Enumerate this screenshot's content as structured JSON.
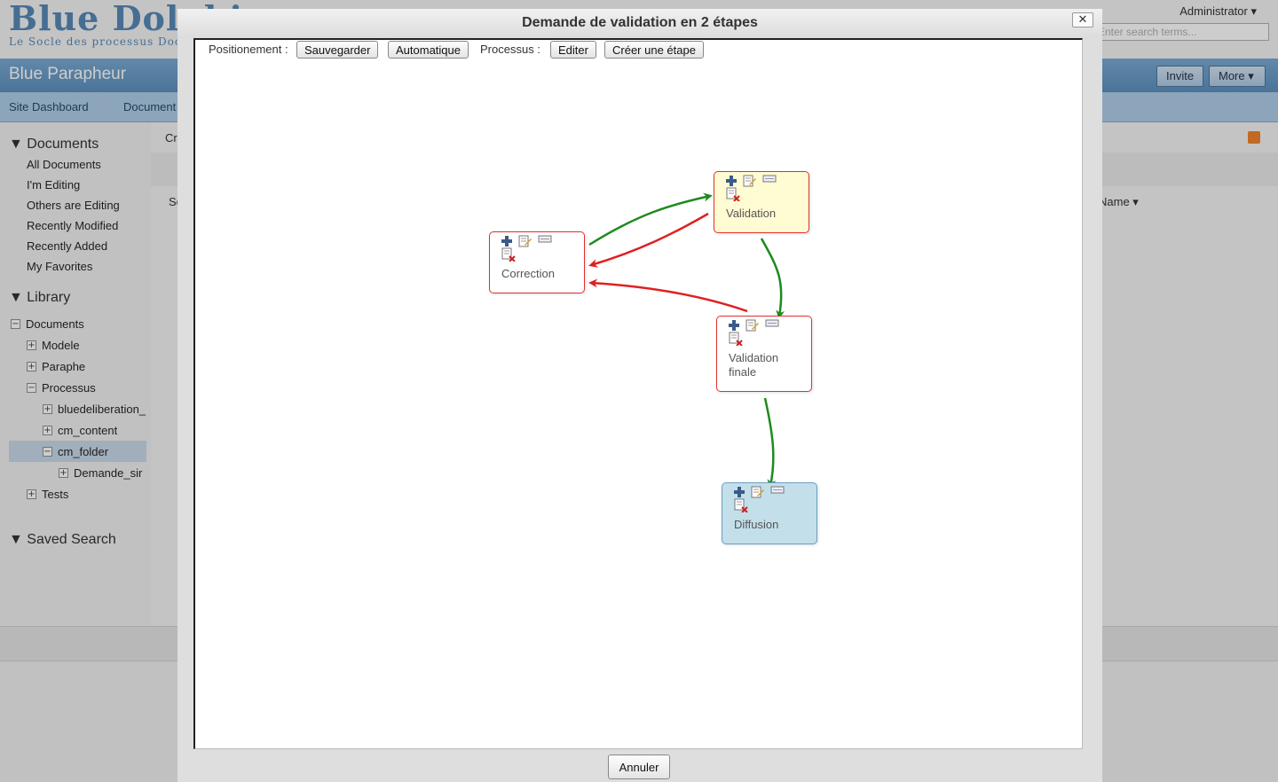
{
  "app": {
    "logo_title": "Blue Dolphin",
    "logo_subtitle": "Le Socle des processus Documentaires",
    "user": "Administrator",
    "search_placeholder": "Enter search terms...",
    "site_title": "Blue Parapheur",
    "invite_label": "Invite",
    "more_label": "More",
    "nav": [
      "Site Dashboard",
      "Document Library"
    ],
    "create_label": "Create...",
    "select_label": "Select",
    "sort_label": "Name"
  },
  "sidebar": {
    "documents_header": "Documents",
    "documents_items": [
      "All Documents",
      "I'm Editing",
      "Others are Editing",
      "Recently Modified",
      "Recently Added",
      "My Favorites"
    ],
    "library_header": "Library",
    "tree": [
      {
        "label": "Documents",
        "level": 0,
        "expanded": true
      },
      {
        "label": "Modele",
        "level": 1,
        "expanded": false
      },
      {
        "label": "Paraphe",
        "level": 1,
        "expanded": false
      },
      {
        "label": "Processus",
        "level": 1,
        "expanded": true
      },
      {
        "label": "bluedeliberation_",
        "level": 2,
        "expanded": false
      },
      {
        "label": "cm_content",
        "level": 2,
        "expanded": false
      },
      {
        "label": "cm_folder",
        "level": 2,
        "expanded": true,
        "selected": true
      },
      {
        "label": "Demande_sir",
        "level": 3,
        "expanded": false
      },
      {
        "label": "Tests",
        "level": 1,
        "expanded": false
      }
    ],
    "saved_search_header": "Saved Search"
  },
  "dialog": {
    "title": "Demande de validation en 2 étapes",
    "close_label": "✕",
    "toolbar": {
      "positioning_label": "Positionement :",
      "save_label": "Sauvegarder",
      "auto_label": "Automatique",
      "process_label": "Processus :",
      "edit_label": "Editer",
      "create_step_label": "Créer une étape"
    },
    "steps": [
      {
        "id": "correction",
        "label": "Correction",
        "style": "default"
      },
      {
        "id": "validation",
        "label": "Validation",
        "style": "current"
      },
      {
        "id": "validation-finale",
        "label": "Validation finale",
        "style": "default"
      },
      {
        "id": "diffusion",
        "label": "Diffusion",
        "style": "final"
      }
    ],
    "transitions": [
      {
        "from": "correction",
        "to": "validation",
        "kind": "approve",
        "color": "#1e8a1e"
      },
      {
        "from": "validation",
        "to": "correction",
        "kind": "reject",
        "color": "#e02020"
      },
      {
        "from": "validation",
        "to": "validation-finale",
        "kind": "approve",
        "color": "#1e8a1e"
      },
      {
        "from": "validation-finale",
        "to": "correction",
        "kind": "reject",
        "color": "#e02020"
      },
      {
        "from": "validation-finale",
        "to": "diffusion",
        "kind": "approve",
        "color": "#1e8a1e"
      }
    ],
    "cancel_label": "Annuler"
  },
  "icons": [
    "add-icon",
    "edit-icon",
    "rename-icon",
    "delete-icon",
    "rss-icon",
    "folder-icon"
  ]
}
